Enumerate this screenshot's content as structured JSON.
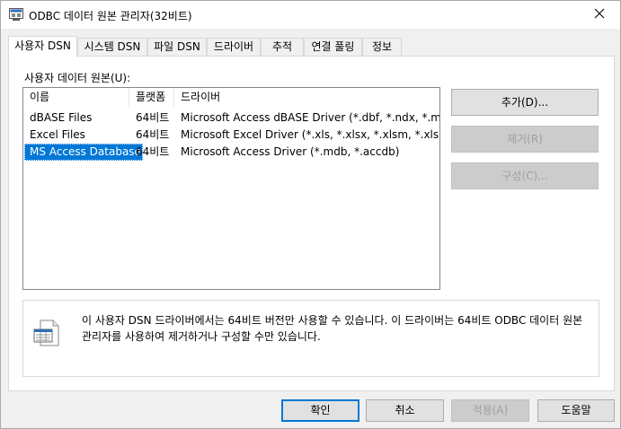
{
  "window": {
    "title": "ODBC 데이터 원본 관리자(32비트)",
    "close_glyph": "✕"
  },
  "tabs": [
    {
      "label": "사용자 DSN",
      "active": true
    },
    {
      "label": "시스템 DSN"
    },
    {
      "label": "파일 DSN"
    },
    {
      "label": "드라이버"
    },
    {
      "label": "추적"
    },
    {
      "label": "연결 풀링"
    },
    {
      "label": "정보"
    }
  ],
  "panel": {
    "group_label": "사용자 데이터 원본(U):",
    "columns": [
      "이름",
      "플랫폼",
      "드라이버"
    ],
    "rows": [
      {
        "name": "dBASE Files",
        "platform": "64비트",
        "driver": "Microsoft Access dBASE Driver (*.dbf, *.ndx, *.mdx)"
      },
      {
        "name": "Excel Files",
        "platform": "64비트",
        "driver": "Microsoft Excel Driver (*.xls, *.xlsx, *.xlsm, *.xlsb)"
      },
      {
        "name": "MS Access Database",
        "platform": "64비트",
        "driver": "Microsoft Access Driver (*.mdb, *.accdb)",
        "selected": true
      }
    ],
    "buttons": {
      "add": "추가(D)...",
      "remove": "제거(R)",
      "configure": "구성(C)..."
    },
    "info_text": "이 사용자 DSN 드라이버에서는 64비트 버전만 사용할 수 있습니다. 이 드라이버는 64비트 ODBC 데이터 원본 관리자를 사용하여 제거하거나 구성할 수만 있습니다."
  },
  "footer": {
    "ok": "확인",
    "cancel": "취소",
    "apply": "적용(A)",
    "help": "도움말"
  },
  "colors": {
    "selection": "#0078d7",
    "disabled_text": "#a0a0a0"
  }
}
